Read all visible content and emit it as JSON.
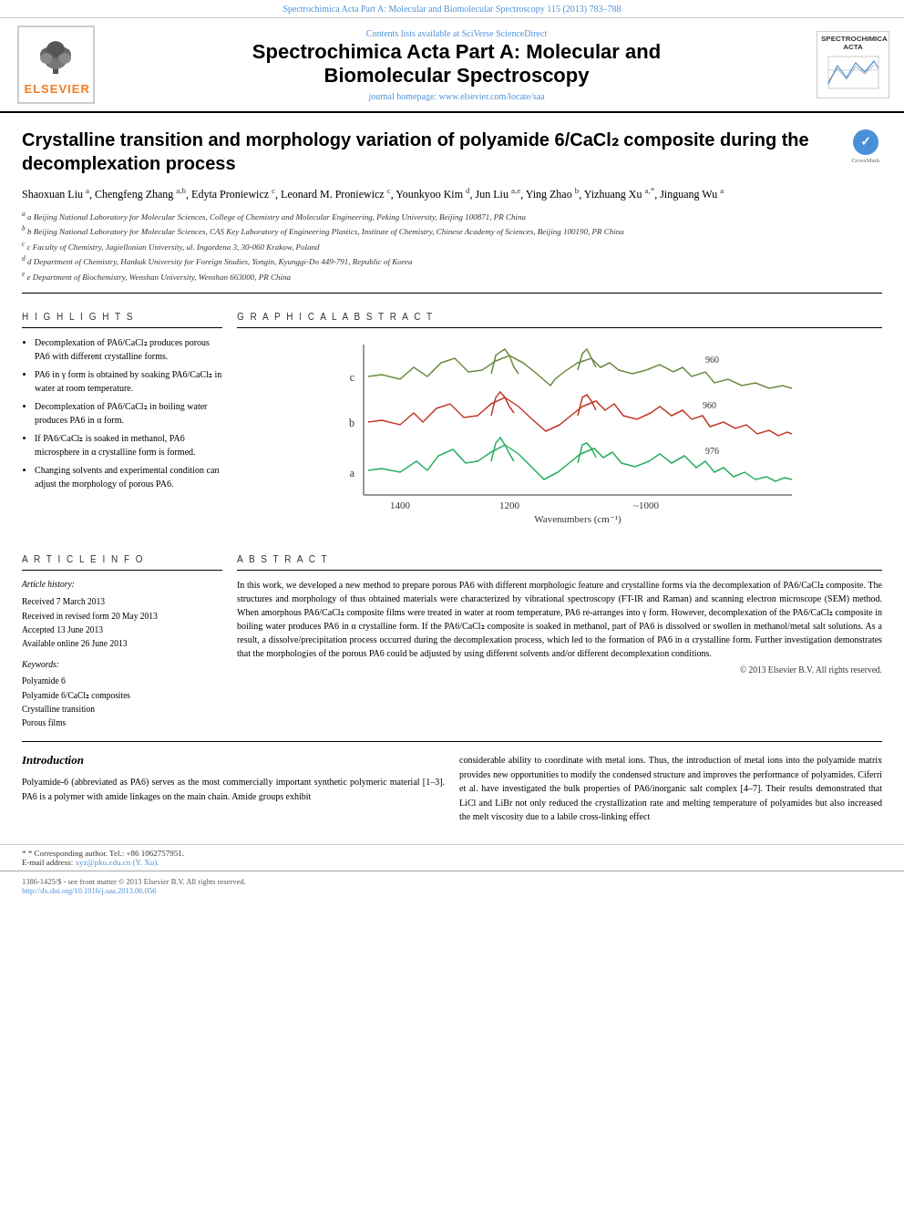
{
  "top_bar": {
    "text": "Spectrochimica Acta Part A: Molecular and Biomolecular Spectroscopy 115 (2013) 783–788"
  },
  "journal_header": {
    "sciverse_text": "Contents lists available at ",
    "sciverse_link": "SciVerse ScienceDirect",
    "title_line1": "Spectrochimica Acta Part A: Molecular and",
    "title_line2": "Biomolecular Spectroscopy",
    "homepage_text": "journal homepage: ",
    "homepage_url": "www.elsevier.com/locate/saa",
    "logo_right_title": "SPECTROCHIMICA ACTA",
    "elsevier_label": "ELSEVIER"
  },
  "article": {
    "title": "Crystalline transition and morphology variation of polyamide 6/CaCl₂ composite during the decomplexation process",
    "crossmark_label": "CrossMark",
    "authors": "Shaoxuan Liu a, Chengfeng Zhang a,b, Edyta Proniewicz c, Leonard M. Proniewicz c, Younkyoo Kim d, Jun Liu a,e, Ying Zhao b, Yizhuang Xu a,*, Jinguang Wu a",
    "affiliations": [
      "a Beijing National Laboratory for Molecular Sciences, College of Chemistry and Molecular Engineering, Peking University, Beijing 100871, PR China",
      "b Beijing National Laboratory for Molecular Sciences, CAS Key Laboratory of Engineering Plastics, Institute of Chemistry, Chinese Academy of Sciences, Beijing 100190, PR China",
      "c Faculty of Chemistry, Jagiellonian University, ul. Ingardena 3, 30-060 Krakow, Poland",
      "d Department of Chemistry, Hankuk University for Foreign Studies, Yongin, Kyunggi-Do 449-791, Republic of Korea",
      "e Department of Biochemistry, Wenshan University, Wenshan 663000, PR China"
    ]
  },
  "highlights": {
    "header": "H I G H L I G H T S",
    "items": [
      "Decomplexation of PA6/CaCl₂ produces porous PA6 with different crystalline forms.",
      "PA6 in γ form is obtained by soaking PA6/CaCl₂ in water at room temperature.",
      "Decomplexation of PA6/CaCl₂ in boiling water produces PA6 in α form.",
      "If PA6/CaCl₂ is soaked in methanol, PA6 microsphere in α crystalline form is formed.",
      "Changing solvents and experimental condition can adjust the morphology of porous PA6."
    ]
  },
  "graphical_abstract": {
    "header": "G R A P H I C A L   A B S T R A C T",
    "x_label": "Wavenumbers (cm⁻¹)",
    "labels": [
      "c",
      "b",
      "a"
    ],
    "peaks": [
      "960",
      "960",
      "976"
    ]
  },
  "article_info": {
    "header": "A R T I C L E   I N F O",
    "history_label": "Article history:",
    "received": "Received 7 March 2013",
    "revised": "Received in revised form 20 May 2013",
    "accepted": "Accepted 13 June 2013",
    "available": "Available online 26 June 2013",
    "keywords_label": "Keywords:",
    "keywords": [
      "Polyamide 6",
      "Polyamide 6/CaCl₂ composites",
      "Crystalline transition",
      "Porous films"
    ]
  },
  "abstract": {
    "header": "A B S T R A C T",
    "text": "In this work, we developed a new method to prepare porous PA6 with different morphologic feature and crystalline forms via the decomplexation of PA6/CaCl₂ composite. The structures and morphology of thus obtained materials were characterized by vibrational spectroscopy (FT-IR and Raman) and scanning electron microscope (SEM) method. When amorphous PA6/CaCl₂ composite films were treated in water at room temperature, PA6 re-arranges into γ form. However, decomplexation of the PA6/CaCl₂ composite in boiling water produces PA6 in α crystalline form. If the PA6/CaCl₂ composite is soaked in methanol, part of PA6 is dissolved or swollen in methanol/metal salt solutions. As a result, a dissolve/precipitation process occurred during the decomplexation process, which led to the formation of PA6 in α crystalline form. Further investigation demonstrates that the morphologies of the porous PA6 could be adjusted by using different solvents and/or different decomplexation conditions.",
    "copyright": "© 2013 Elsevier B.V. All rights reserved."
  },
  "introduction": {
    "title": "Introduction",
    "left_text": "Polyamide-6 (abbreviated as PA6) serves as the most commercially important synthetic polymeric material [1–3]. PA6 is a polymer with amide linkages on the main chain. Amide groups exhibit",
    "right_text": "considerable ability to coordinate with metal ions. Thus, the introduction of metal ions into the polyamide matrix provides new opportunities to modify the condensed structure and improves the performance of polyamides. Ciferri et al. have investigated the bulk properties of PA6/inorganic salt complex [4–7]. Their results demonstrated that LiCl and LiBr not only reduced the crystallization rate and melting temperature of polyamides but also increased the melt viscosity due to a labile cross-linking effect"
  },
  "footer": {
    "issn": "1386-1425/$ - see front matter © 2013 Elsevier B.V. All rights reserved.",
    "doi": "http://dx.doi.org/10.1016/j.saa.2013.06.056",
    "corresponding": "* Corresponding author. Tel.: +86 10627579​51.",
    "email_label": "E-mail address: ",
    "email": "xyz@pku.edu.cn (Y. Xu)."
  }
}
